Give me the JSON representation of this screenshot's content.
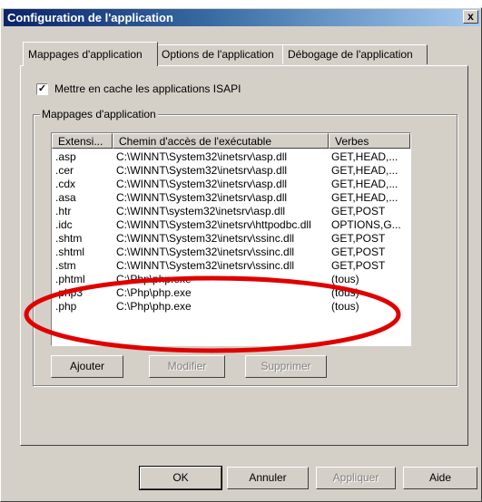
{
  "window": {
    "title": "Configuration de l'application",
    "close_label": "x"
  },
  "tabs": [
    {
      "label": "Mappages d'application"
    },
    {
      "label": "Options de l'application"
    },
    {
      "label": "Débogage de l'application"
    }
  ],
  "cache_checkbox": {
    "label": "Mettre en cache les applications ISAPI",
    "checked": true,
    "check_glyph": "✓"
  },
  "group": {
    "title": "Mappages d'application"
  },
  "list": {
    "columns": [
      "Extensi...",
      "Chemin d'accès de l'exécutable",
      "Verbes"
    ],
    "rows": [
      {
        "ext": ".asp",
        "path": "C:\\WINNT\\System32\\inetsrv\\asp.dll",
        "verbs": "GET,HEAD,..."
      },
      {
        "ext": ".cer",
        "path": "C:\\WINNT\\System32\\inetsrv\\asp.dll",
        "verbs": "GET,HEAD,..."
      },
      {
        "ext": ".cdx",
        "path": "C:\\WINNT\\System32\\inetsrv\\asp.dll",
        "verbs": "GET,HEAD,..."
      },
      {
        "ext": ".asa",
        "path": "C:\\WINNT\\System32\\inetsrv\\asp.dll",
        "verbs": "GET,HEAD,..."
      },
      {
        "ext": ".htr",
        "path": "C:\\WINNT\\system32\\inetsrv\\asp.dll",
        "verbs": "GET,POST"
      },
      {
        "ext": ".idc",
        "path": "C:\\WINNT\\System32\\inetsrv\\httpodbc.dll",
        "verbs": "OPTIONS,G..."
      },
      {
        "ext": ".shtm",
        "path": "C:\\WINNT\\System32\\inetsrv\\ssinc.dll",
        "verbs": "GET,POST"
      },
      {
        "ext": ".shtml",
        "path": "C:\\WINNT\\System32\\inetsrv\\ssinc.dll",
        "verbs": "GET,POST"
      },
      {
        "ext": ".stm",
        "path": "C:\\WINNT\\System32\\inetsrv\\ssinc.dll",
        "verbs": "GET,POST"
      },
      {
        "ext": ".phtml",
        "path": "C:\\Php\\php.exe",
        "verbs": "(tous)"
      },
      {
        "ext": ".php3",
        "path": "C:\\Php\\php.exe",
        "verbs": "(tous)"
      },
      {
        "ext": ".php",
        "path": "C:\\Php\\php.exe",
        "verbs": "(tous)"
      }
    ]
  },
  "buttons": {
    "add": "Ajouter",
    "edit": "Modifier",
    "remove": "Supprimer"
  },
  "footer": {
    "ok": "OK",
    "cancel": "Annuler",
    "apply": "Appliquer",
    "help": "Aide"
  },
  "annotation": {
    "color": "#e00000",
    "shape": "ellipse-highlight"
  }
}
